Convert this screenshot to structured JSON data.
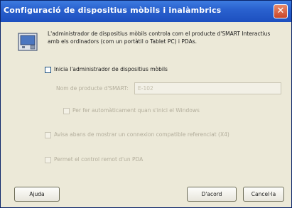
{
  "window": {
    "title": "Configuració de dispositius mòbils i inalàmbrics"
  },
  "info": {
    "text": "L'administrador de dispositius mòbils controla com el producte d'SMART Interactius amb els ordinadors (com un portàtil o Tablet PC) i PDAs."
  },
  "options": {
    "start_manager_label": "Inicia l'administrador de dispositius mòbils",
    "product_name_label": "Nom de producte d'SMART:",
    "product_name_value": "E-102",
    "auto_start_label": "Per fer automàticament quan s'inici el Windows",
    "warn_label": "Avisa abans de mostrar un connexion compatible referenciat (X4)",
    "remote_pda_label": "Permet el control remot d'un PDA"
  },
  "buttons": {
    "help": "Ajuda",
    "ok": "D'acord",
    "cancel": "Cancel·la"
  },
  "colors": {
    "title_bar": "#2a62cf",
    "close_button": "#c9462a",
    "window_bg": "#ece9d8"
  }
}
